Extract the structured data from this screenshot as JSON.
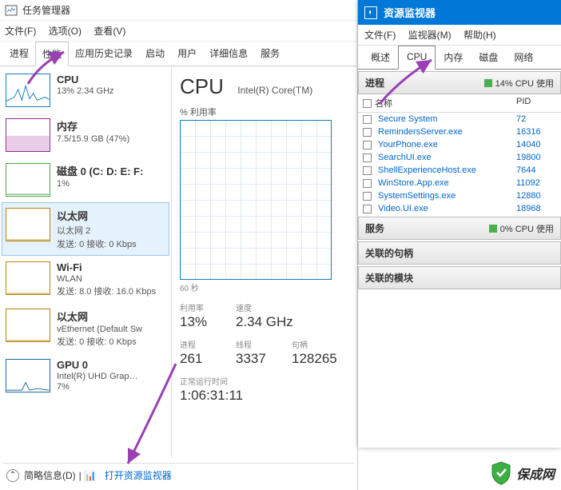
{
  "task_manager": {
    "title": "任务管理器",
    "menu": {
      "file": "文件(F)",
      "options": "选项(O)",
      "view": "查看(V)"
    },
    "tabs": [
      "进程",
      "性能",
      "应用历史记录",
      "启动",
      "用户",
      "详细信息",
      "服务"
    ],
    "active_tab": 1,
    "sidebar": [
      {
        "title": "CPU",
        "sub": "13%  2.34 GHz",
        "type": "cpu"
      },
      {
        "title": "内存",
        "sub": "7.5/15.9 GB (47%)",
        "type": "mem"
      },
      {
        "title": "磁盘 0 (C: D: E: F:",
        "sub": "1%",
        "type": "disk"
      },
      {
        "title": "以太网",
        "sub": "以太网 2",
        "sub2": "发送: 0 接收: 0 Kbps",
        "type": "net",
        "selected": true
      },
      {
        "title": "Wi-Fi",
        "sub": "WLAN",
        "sub2": "发送: 8.0 接收: 16.0 Kbps",
        "type": "net"
      },
      {
        "title": "以太网",
        "sub": "vEthernet (Default Sw",
        "sub2": "发送: 0 接收: 0 Kbps",
        "type": "net"
      },
      {
        "title": "GPU 0",
        "sub": "Intel(R) UHD Grap…",
        "sub2": "7%",
        "type": "gpu"
      }
    ],
    "main": {
      "heading": "CPU",
      "cpu_name": "Intel(R) Core(TM)",
      "util_label": "% 利用率",
      "axis_label": "60 秒",
      "stats": {
        "util": {
          "label": "利用率",
          "value": "13%"
        },
        "speed": {
          "label": "速度",
          "value": "2.34 GHz"
        },
        "processes": {
          "label": "进程",
          "value": "261"
        },
        "threads": {
          "label": "线程",
          "value": "3337"
        },
        "handles": {
          "label": "句柄",
          "value": "128265"
        },
        "uptime": {
          "label": "正常运行时间",
          "value": "1:06:31:11"
        }
      }
    },
    "footer": {
      "brief": "简略信息(D)",
      "link": "打开资源监视器"
    }
  },
  "resource_monitor": {
    "title": "资源监视器",
    "menu": {
      "file": "文件(F)",
      "monitor": "监视器(M)",
      "help": "帮助(H)"
    },
    "tabs": [
      "概述",
      "CPU",
      "内存",
      "磁盘",
      "网络"
    ],
    "active_tab": 1,
    "sections": {
      "processes": {
        "title": "进程",
        "badge": "14% CPU 使用"
      },
      "services": {
        "title": "服务",
        "badge": "0% CPU 使用"
      },
      "handles": {
        "title": "关联的句柄"
      },
      "modules": {
        "title": "关联的模块"
      }
    },
    "table": {
      "col_name": "名称",
      "col_pid": "PID",
      "rows": [
        {
          "name": "Secure System",
          "pid": "72"
        },
        {
          "name": "RemindersServer.exe",
          "pid": "16316"
        },
        {
          "name": "YourPhone.exe",
          "pid": "14040"
        },
        {
          "name": "SearchUI.exe",
          "pid": "19800"
        },
        {
          "name": "ShellExperienceHost.exe",
          "pid": "7644"
        },
        {
          "name": "WinStore.App.exe",
          "pid": "11092"
        },
        {
          "name": "SystemSettings.exe",
          "pid": "12880"
        },
        {
          "name": "Video.UI.exe",
          "pid": "18968"
        }
      ]
    }
  },
  "watermark": "保成网"
}
